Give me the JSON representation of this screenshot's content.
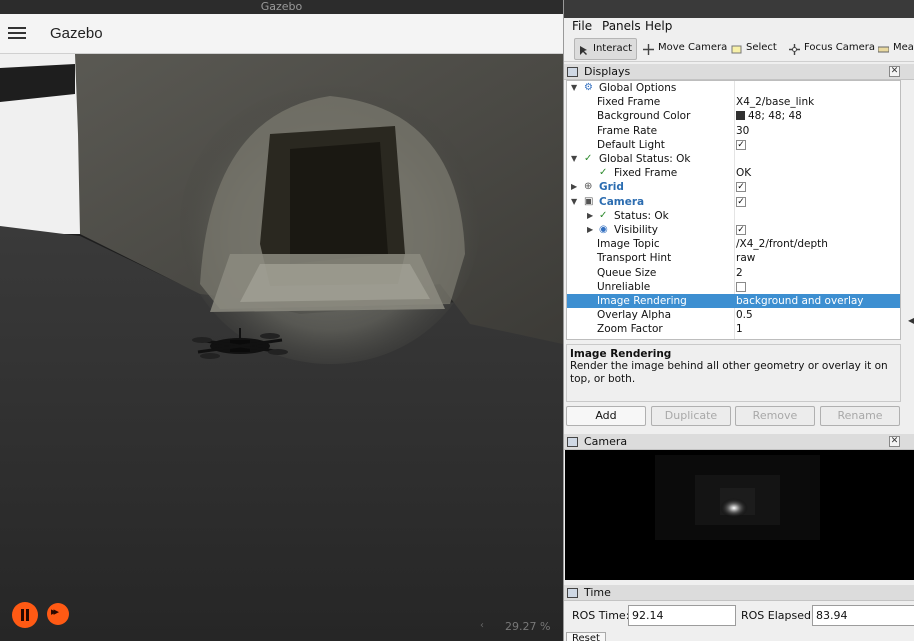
{
  "gazebo": {
    "window_title": "Gazebo",
    "app_title": "Gazebo",
    "real_time_factor": "29.27 %",
    "controls": {
      "pause_icon": "pause-icon",
      "step_icon": "fast-forward-icon"
    }
  },
  "rviz": {
    "menu": [
      "File",
      "Panels",
      "Help"
    ],
    "toolbar": [
      "Interact",
      "Move Camera",
      "Select",
      "Focus Camera",
      "Meas"
    ],
    "displays_panel": {
      "title": "Displays",
      "rows": [
        {
          "label": "Global Options",
          "value": ""
        },
        {
          "label": "Fixed Frame",
          "value": "X4_2/base_link"
        },
        {
          "label": "Background Color",
          "value": "48; 48; 48"
        },
        {
          "label": "Frame Rate",
          "value": "30"
        },
        {
          "label": "Default Light",
          "value": ""
        },
        {
          "label": "Global Status: Ok",
          "value": ""
        },
        {
          "label": "Fixed Frame",
          "value": "OK"
        },
        {
          "label": "Grid",
          "value": ""
        },
        {
          "label": "Camera",
          "value": ""
        },
        {
          "label": "Status: Ok",
          "value": ""
        },
        {
          "label": "Visibility",
          "value": ""
        },
        {
          "label": "Image Topic",
          "value": "/X4_2/front/depth"
        },
        {
          "label": "Transport Hint",
          "value": "raw"
        },
        {
          "label": "Queue Size",
          "value": "2"
        },
        {
          "label": "Unreliable",
          "value": ""
        },
        {
          "label": "Image Rendering",
          "value": "background and overlay"
        },
        {
          "label": "Overlay Alpha",
          "value": "0.5"
        },
        {
          "label": "Zoom Factor",
          "value": "1"
        }
      ],
      "checkbox_checked": "✓",
      "background_color_hex": "#303030",
      "selection_color": "#3d8fd1"
    },
    "description": {
      "title": "Image Rendering",
      "text": "Render the image behind all other geometry or overlay it on top, or both."
    },
    "buttons": {
      "add": "Add",
      "duplicate": "Duplicate",
      "remove": "Remove",
      "rename": "Rename"
    },
    "camera_panel": {
      "title": "Camera"
    },
    "time_panel": {
      "title": "Time",
      "ros_time_label": "ROS Time:",
      "ros_time_value": "92.14",
      "ros_elapsed_label": "ROS Elapsed:",
      "ros_elapsed_value": "83.94",
      "reset_label": "Reset"
    }
  }
}
